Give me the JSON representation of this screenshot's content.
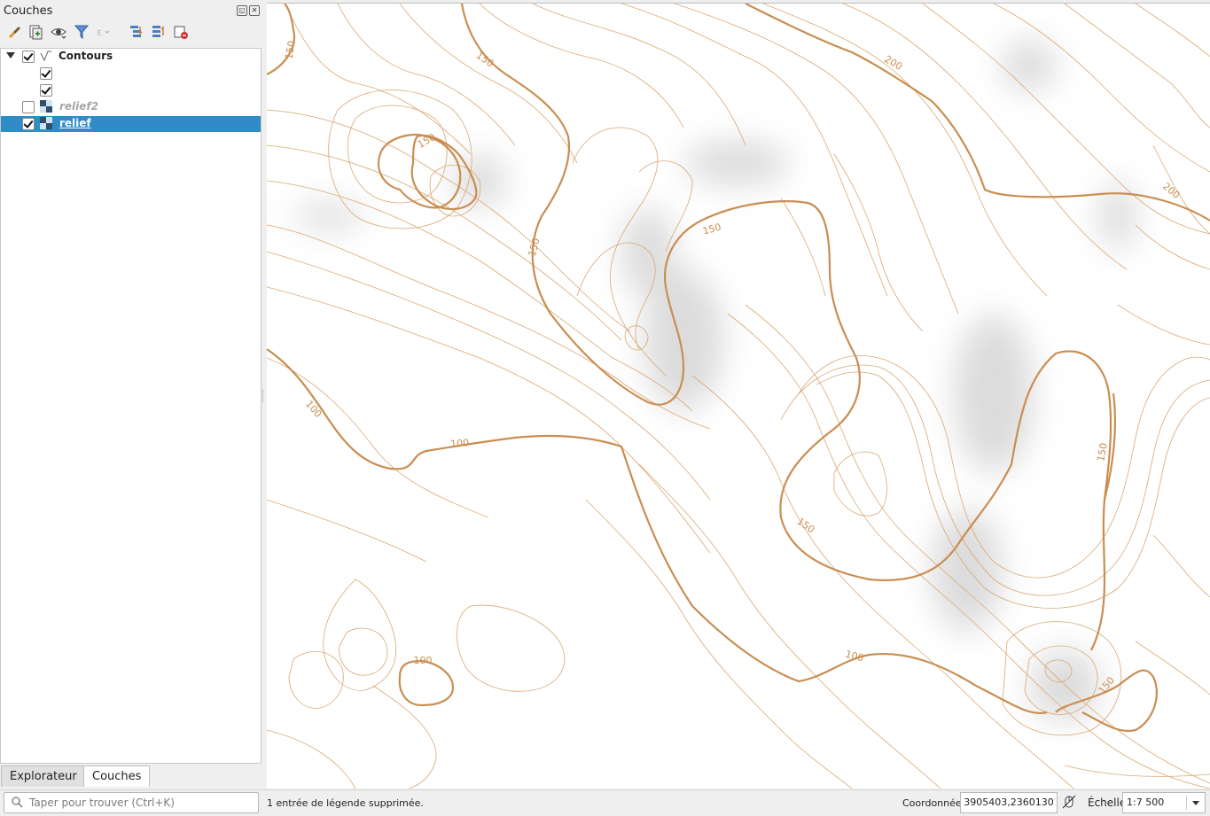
{
  "panel": {
    "title": "Couches",
    "toolbar": [
      {
        "icon": "style-brush-icon"
      },
      {
        "icon": "add-group-icon"
      },
      {
        "icon": "visibility-eye-icon"
      },
      {
        "icon": "filter-icon"
      },
      {
        "icon": "filter-expression-icon"
      },
      {
        "icon": "expand-all-icon"
      },
      {
        "icon": "collapse-all-icon"
      },
      {
        "icon": "remove-layer-icon"
      }
    ]
  },
  "layers": {
    "contours": {
      "label": "Contours",
      "checked": true,
      "expanded": true
    },
    "legend": [
      {
        "checked": true
      },
      {
        "checked": true
      }
    ],
    "relief2": {
      "label": "relief2",
      "checked": false
    },
    "relief": {
      "label": "relief",
      "checked": true,
      "selected": true
    }
  },
  "tabs": {
    "explorer": "Explorateur",
    "layers": "Couches"
  },
  "map": {
    "contour_color": "#d6a36c",
    "index_color": "#c98e52",
    "labels": [
      "150",
      "150",
      "200",
      "150",
      "150",
      "150",
      "200",
      "100",
      "100",
      "150",
      "150",
      "100",
      "100",
      "150"
    ]
  },
  "status": {
    "search_placeholder": "Taper pour trouver (Ctrl+K)",
    "message": "1 entrée de légende supprimée.",
    "coord_label": "Coordonnée",
    "coord_value": "3905403,2360130",
    "scale_label": "Échelle",
    "scale_value": "1:7 500"
  }
}
